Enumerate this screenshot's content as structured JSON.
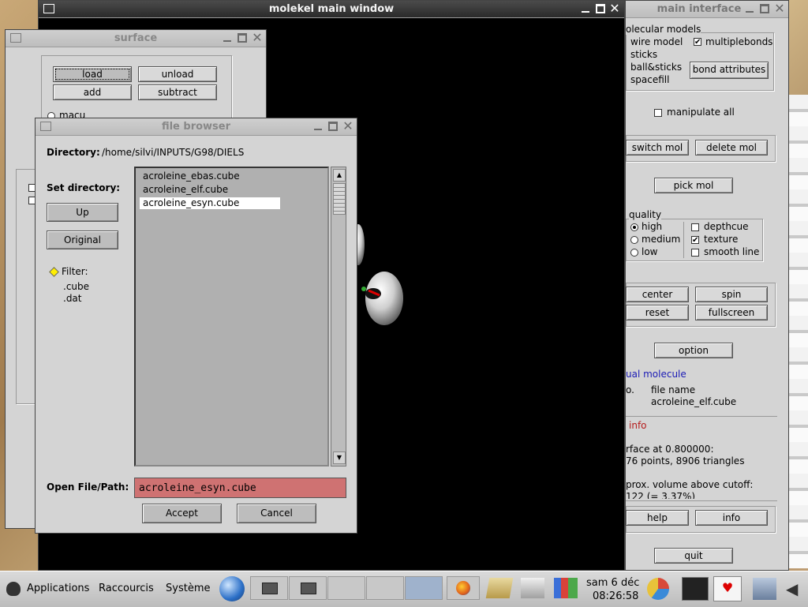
{
  "main_window": {
    "title": "molekel main window"
  },
  "main_interface": {
    "title": "main interface",
    "molecular_models_label": "olecular models",
    "models": [
      "wire model",
      "sticks",
      "ball&sticks",
      "spacefill"
    ],
    "multiplebonds_label": "multiplebonds",
    "bond_attributes_label": "bond attributes",
    "manipulate_all_label": "manipulate all",
    "switch_mol_label": "switch mol",
    "delete_mol_label": "delete mol",
    "pick_mol_label": "pick mol",
    "quality_label": "quality",
    "quality_options": [
      "high",
      "medium",
      "low"
    ],
    "depthcue_label": "depthcue",
    "texture_label": "texture",
    "smooth_line_label": "smooth line",
    "center_label": "center",
    "spin_label": "spin",
    "reset_label": "reset",
    "fullscreen_label": "fullscreen",
    "option_label": "option",
    "actual_molecule_label": "ual molecule",
    "no_label": "o.",
    "file_name_header": "file name",
    "file_name_value": "acroleine_elf.cube",
    "info_header": "info",
    "surface_info_1": "rface at 0.800000:",
    "surface_info_2": "76 points, 8906 triangles",
    "volume_info_1": "prox. volume above cutoff:",
    "volume_info_2": "122 (= 3.37%)",
    "help_label": "help",
    "info_label": "info",
    "quit_label": "quit"
  },
  "surface_window": {
    "title": "surface",
    "load_label": "load",
    "unload_label": "unload",
    "add_label": "add",
    "subtract_label": "subtract",
    "macu_label": "macu"
  },
  "file_browser": {
    "title": "file browser",
    "directory_label": "Directory:",
    "directory_value": "/home/silvi/INPUTS/G98/DIELS",
    "set_directory_label": "Set directory:",
    "up_label": "Up",
    "original_label": "Original",
    "filter_label": "Filter:",
    "filters": [
      ".cube",
      ".dat"
    ],
    "files": [
      "acroleine_ebas.cube",
      "acroleine_elf.cube",
      "acroleine_esyn.cube"
    ],
    "open_file_label": "Open File/Path:",
    "open_file_value": "acroleine_esyn.cube",
    "accept_label": "Accept",
    "cancel_label": "Cancel"
  },
  "taskbar": {
    "applications_label": "Applications",
    "shortcuts_label": "Raccourcis",
    "system_label": "Système",
    "date": "sam  6 déc",
    "time": "08:26:58"
  }
}
